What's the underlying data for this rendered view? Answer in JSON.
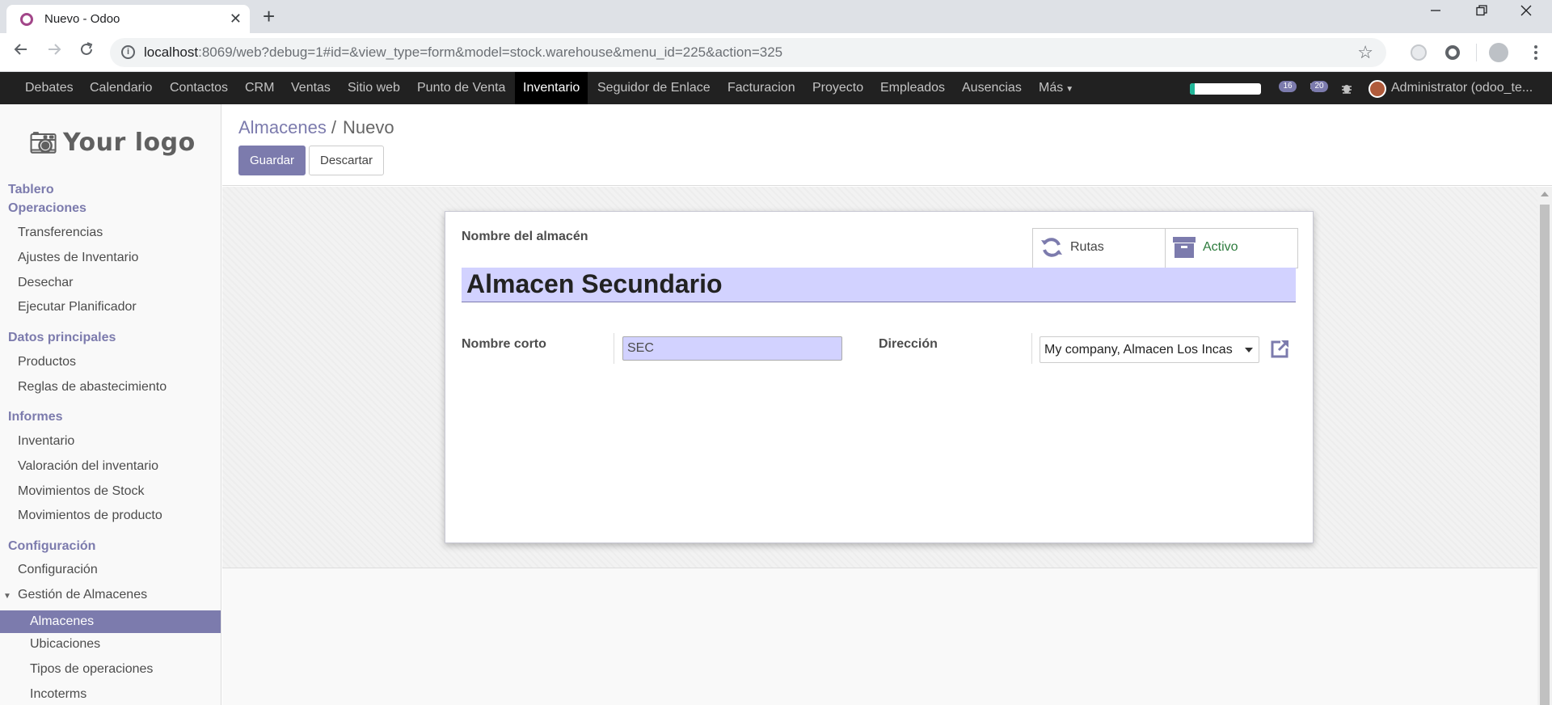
{
  "browser": {
    "tab_title": "Nuevo - Odoo",
    "tab_close": "✕",
    "new_tab": "+",
    "url_host": "localhost",
    "url_rest": ":8069/web?debug=1#id=&view_type=form&model=stock.warehouse&menu_id=225&action=325",
    "info_glyph": "i",
    "star_glyph": "☆"
  },
  "topmenu": {
    "items": [
      "Debates",
      "Calendario",
      "Contactos",
      "CRM",
      "Ventas",
      "Sitio web",
      "Punto de Venta",
      "Inventario",
      "Seguidor de Enlace",
      "Facturacion",
      "Proyecto",
      "Empleados",
      "Ausencias",
      "Más"
    ],
    "active": "Inventario",
    "progress_fraction": 0.07,
    "activity_count": "16",
    "message_count": "20",
    "user": "Administrator (odoo_te..."
  },
  "sidebar": {
    "logo": "Your logo",
    "sections": {
      "tablero": "Tablero",
      "operaciones": "Operaciones",
      "transferencias": "Transferencias",
      "ajustes": "Ajustes de Inventario",
      "desechar": "Desechar",
      "planificador": "Ejecutar Planificador",
      "datos": "Datos principales",
      "productos": "Productos",
      "reglas": "Reglas de abastecimiento",
      "informes": "Informes",
      "inventario": "Inventario",
      "valoracion": "Valoración del inventario",
      "mov_stock": "Movimientos de Stock",
      "mov_producto": "Movimientos de producto",
      "configuracion_head": "Configuración",
      "configuracion": "Configuración",
      "gestion": "Gestión de Almacenes",
      "almacenes": "Almacenes",
      "ubicaciones": "Ubicaciones",
      "tipos": "Tipos de operaciones",
      "incoterms": "Incoterms"
    }
  },
  "control_panel": {
    "breadcrumb_parent": "Almacenes",
    "breadcrumb_sep": "/",
    "breadcrumb_current": "Nuevo",
    "save": "Guardar",
    "discard": "Descartar"
  },
  "form": {
    "name_label": "Nombre del almacén",
    "name_value": "Almacen Secundario",
    "routes_button": "Rutas",
    "active_button": "Activo",
    "short_label": "Nombre corto",
    "short_value": "SEC",
    "address_label": "Dirección",
    "address_value": "My company, Almacen Los Incas"
  },
  "colors": {
    "brand": "#7c7bad",
    "topmenu_bg": "#212121",
    "field_required_bg": "#d2d2ff",
    "active_green": "#2d7b3d"
  }
}
